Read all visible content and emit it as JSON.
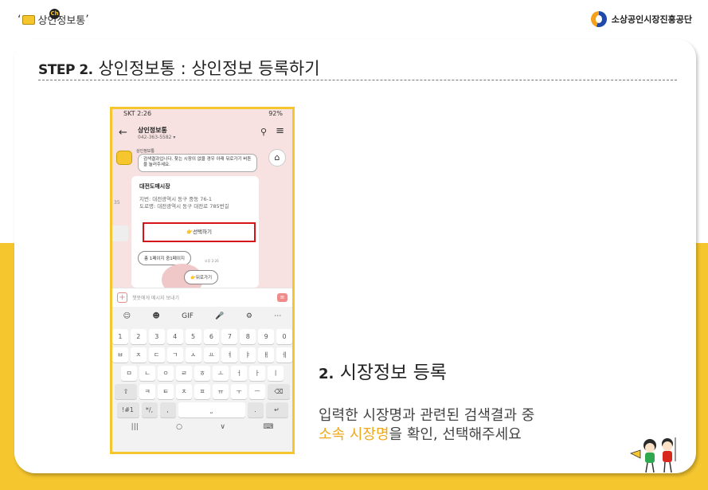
{
  "header": {
    "app_logo_text": "상인정보통",
    "app_logo_badge": "Ch",
    "quote_open": "‘",
    "quote_close": "’",
    "org_name": "소상공인시장진흥공단"
  },
  "step": {
    "step_label": "STEP 2.",
    "title": "상인정보통 : 상인정보 등록하기"
  },
  "phone": {
    "status_left": "SKT 2:26",
    "status_right": "92%",
    "chat_title": "상인정보통",
    "chat_phone": "042-363-5582 ▾",
    "bot_name": "상인정보통",
    "bubble_text": "검색결과입니다. 찾는 시장이 없을 경우 아래 뒤로가기 버튼을 눌러주세요.",
    "market_name": "대전도매시장",
    "address_lot": "지번: 대전광역시 동구 중동 76-1",
    "address_road": "도로명: 대전광역시 동구 대전로 785번길",
    "side_number": "35",
    "select_button": "👉선택하기",
    "page_info": "총 1페이지 중1페이지",
    "time_label": "오후 2:26",
    "back_button": "👉뒤로가기",
    "input_placeholder": "챗봇에게 메시지 보내기",
    "keyboard": {
      "tools": [
        "☺",
        "☻",
        "GIF",
        "🎤",
        "⚙",
        "⋯"
      ],
      "row_numbers": [
        "1",
        "2",
        "3",
        "4",
        "5",
        "6",
        "7",
        "8",
        "9",
        "0"
      ],
      "row_1": [
        "ㅂ",
        "ㅈ",
        "ㄷ",
        "ㄱ",
        "ㅅ",
        "ㅛ",
        "ㅕ",
        "ㅑ",
        "ㅐ",
        "ㅔ"
      ],
      "row_2": [
        "ㅁ",
        "ㄴ",
        "ㅇ",
        "ㄹ",
        "ㅎ",
        "ㅗ",
        "ㅓ",
        "ㅏ",
        "ㅣ"
      ],
      "row_3": [
        "⇧",
        "ㅋ",
        "ㅌ",
        "ㅊ",
        "ㅍ",
        "ㅠ",
        "ㅜ",
        "ㅡ",
        "⌫"
      ],
      "row_4": [
        "!#1",
        "*/,",
        ",",
        "⎵",
        ".",
        "↵"
      ],
      "nav": [
        "|||",
        "○",
        "∨",
        "⌨"
      ]
    }
  },
  "section": {
    "number": "2.",
    "title": "시장정보 등록",
    "desc_line1": "입력한 시장명과 관련된 검색결과 중",
    "desc_highlight": "소속 시장명",
    "desc_line2_rest": "을 확인, 선택해주세요"
  },
  "colors": {
    "accent_yellow": "#f5c62e",
    "highlight_orange": "#f0a81b",
    "select_border_red": "#d4141b",
    "chat_bg_pink": "#f7e1e1"
  }
}
